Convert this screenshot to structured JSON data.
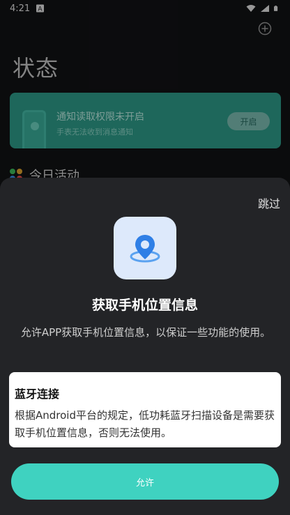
{
  "status_bar": {
    "time": "4:21",
    "icons": [
      "notification-a-icon",
      "wifi-icon",
      "signal-icon",
      "battery-icon"
    ]
  },
  "header": {
    "title": "状态",
    "add_icon": "plus-circle-icon"
  },
  "notice_card": {
    "title": "通知读取权限未开启",
    "subtitle": "手表无法收到消息通知",
    "button": "开启",
    "color": "#2f9f8d"
  },
  "activity": {
    "label": "今日活动",
    "dot_colors": [
      "#3fbf5c",
      "#e2a62f",
      "#3a8ee6",
      "#e24a4a"
    ]
  },
  "permission_sheet": {
    "skip": "跳过",
    "icon": "location-pin-icon",
    "title": "获取手机位置信息",
    "description": "允许APP获取手机位置信息，以保证一些功能的使用。",
    "info_title": "蓝牙连接",
    "info_body": "根据Android平台的规定，低功耗蓝牙扫描设备是需要获取手机位置信息，否则无法使用。",
    "allow_button": "允许",
    "accent_color": "#3fd2c0"
  }
}
